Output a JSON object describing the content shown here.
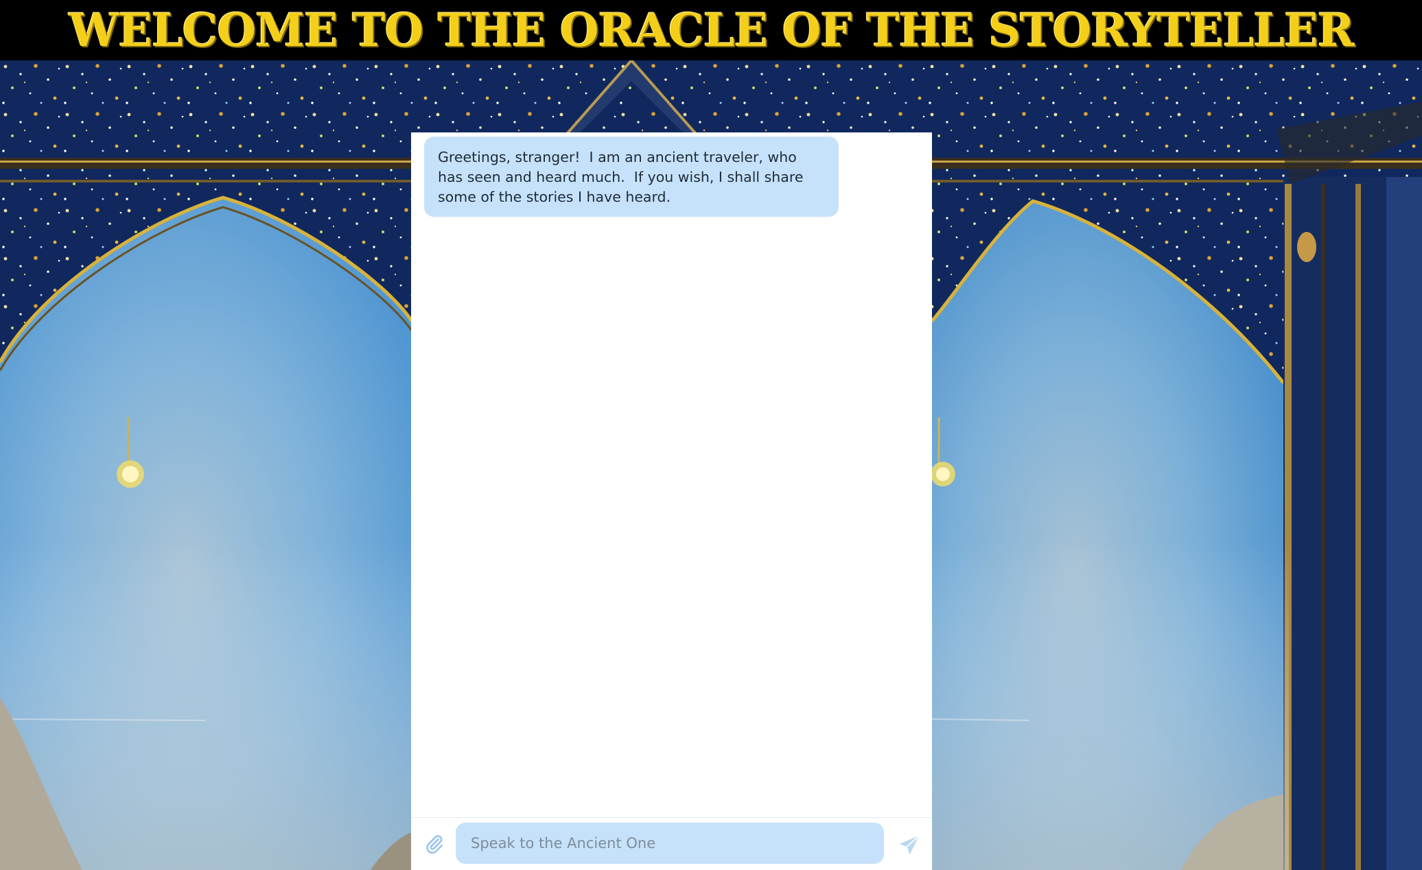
{
  "banner": {
    "title": "WELCOME TO THE ORACLE OF THE STORYTELLER"
  },
  "chat": {
    "messages": [
      {
        "sender": "bot",
        "text": "Greetings, stranger!  I am an ancient traveler, who has seen and heard much.  If you wish, I shall share some of the stories I have heard."
      }
    ],
    "input": {
      "placeholder": "Speak to the Ancient One",
      "value": ""
    },
    "icons": {
      "attach": "paperclip-icon",
      "send": "send-icon"
    }
  },
  "colors": {
    "banner_bg": "#000000",
    "banner_text": "#f4cf1a",
    "bubble_bg": "#c6e2fa",
    "input_bg": "#c6e2fa",
    "icon_tint": "#9fc6ea",
    "sky": "#5b9fd4",
    "frame_blue": "#0d2457",
    "gold": "#d8b23a"
  }
}
